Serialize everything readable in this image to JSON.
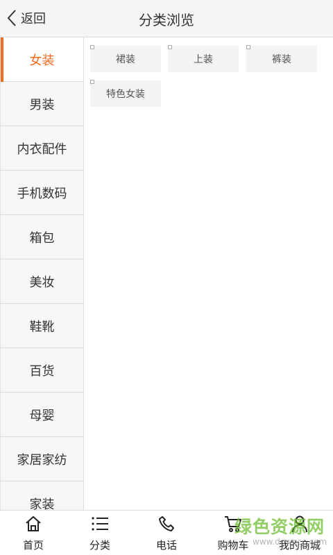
{
  "header": {
    "back_label": "返回",
    "title": "分类浏览"
  },
  "sidebar": {
    "items": [
      {
        "label": "女装",
        "active": true
      },
      {
        "label": "男装"
      },
      {
        "label": "内衣配件"
      },
      {
        "label": "手机数码"
      },
      {
        "label": "箱包"
      },
      {
        "label": "美妆"
      },
      {
        "label": "鞋靴"
      },
      {
        "label": "百货"
      },
      {
        "label": "母婴"
      },
      {
        "label": "家居家纺"
      },
      {
        "label": "家装"
      }
    ]
  },
  "subcategories": [
    {
      "label": "裙装"
    },
    {
      "label": "上装"
    },
    {
      "label": "裤装"
    },
    {
      "label": "特色女装"
    }
  ],
  "tabbar": {
    "items": [
      {
        "label": "首页",
        "icon": "home-icon"
      },
      {
        "label": "分类",
        "icon": "list-icon"
      },
      {
        "label": "电话",
        "icon": "phone-icon"
      },
      {
        "label": "购物车",
        "icon": "cart-icon"
      },
      {
        "label": "我的商城",
        "icon": "user-icon"
      }
    ]
  },
  "watermark": {
    "text": "绿色资源网",
    "url": "www.downcc.com"
  },
  "colors": {
    "accent": "#f26b20",
    "watermark": "#6ebe32"
  }
}
